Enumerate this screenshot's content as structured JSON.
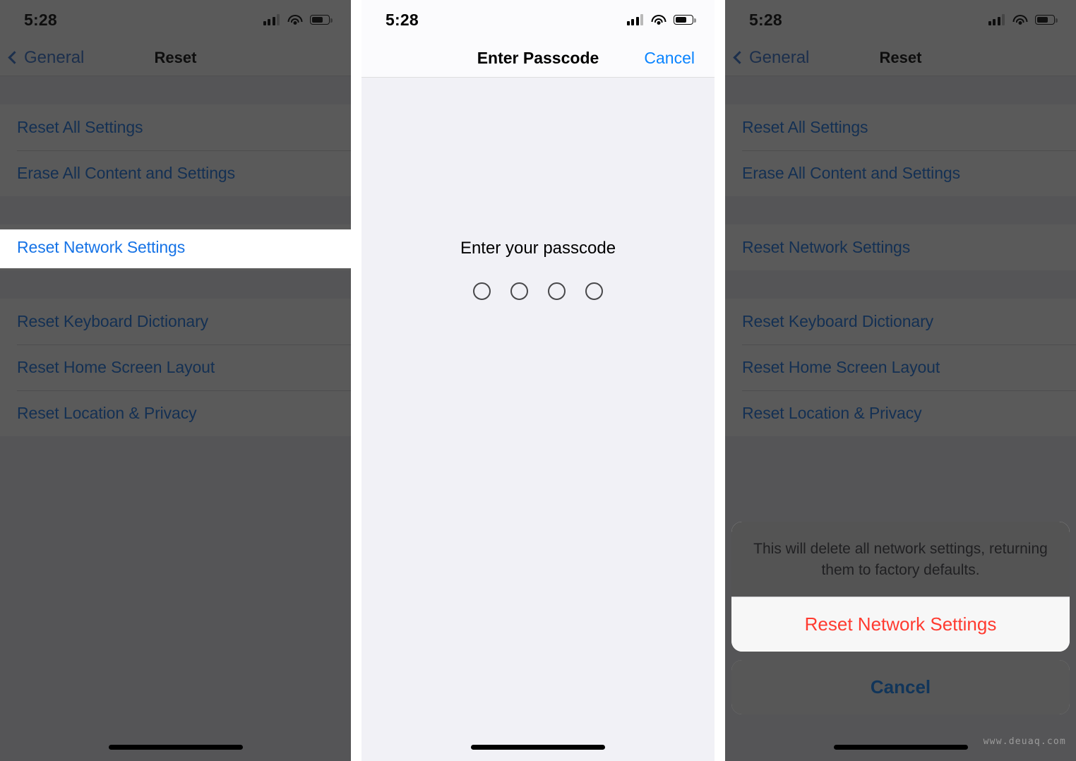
{
  "meta": {
    "watermark": "www.deuaq.com"
  },
  "status_bar": {
    "time": "5:28",
    "signal_icon": "cellular-signal-icon",
    "wifi_icon": "wifi-icon",
    "battery_icon": "battery-icon",
    "battery_level_percent": 60,
    "signal_bars_filled": 3,
    "signal_bars_total": 4
  },
  "colors": {
    "link_blue": "#1673e6",
    "tint_blue": "#0a84ff",
    "destructive_red": "#ff3b30",
    "list_background": "#efeff4",
    "row_background": "#ffffff",
    "dim_overlay": "rgba(20,20,20,0.70)",
    "passcode_background": "#f1f1f6"
  },
  "panel1": {
    "nav": {
      "back_label": "General",
      "title": "Reset",
      "back_icon": "chevron-left-icon"
    },
    "group_a": [
      {
        "label": "Reset All Settings"
      },
      {
        "label": "Erase All Content and Settings"
      }
    ],
    "group_b": [
      {
        "label": "Reset Network Settings",
        "highlighted": true
      }
    ],
    "group_c": [
      {
        "label": "Reset Keyboard Dictionary"
      },
      {
        "label": "Reset Home Screen Layout"
      },
      {
        "label": "Reset Location & Privacy"
      }
    ]
  },
  "panel2": {
    "nav": {
      "title": "Enter Passcode",
      "cancel_label": "Cancel"
    },
    "prompt": "Enter your passcode",
    "passcode_dots": 4,
    "passcode_entered": 0
  },
  "panel3": {
    "nav": {
      "back_label": "General",
      "title": "Reset",
      "back_icon": "chevron-left-icon"
    },
    "group_a": [
      {
        "label": "Reset All Settings"
      },
      {
        "label": "Erase All Content and Settings"
      }
    ],
    "group_b": [
      {
        "label": "Reset Network Settings"
      }
    ],
    "group_c": [
      {
        "label": "Reset Keyboard Dictionary"
      },
      {
        "label": "Reset Home Screen Layout"
      },
      {
        "label": "Reset Location & Privacy"
      }
    ],
    "action_sheet": {
      "message": "This will delete all network settings, returning them to factory defaults.",
      "destructive_label": "Reset Network Settings",
      "cancel_label": "Cancel"
    }
  }
}
